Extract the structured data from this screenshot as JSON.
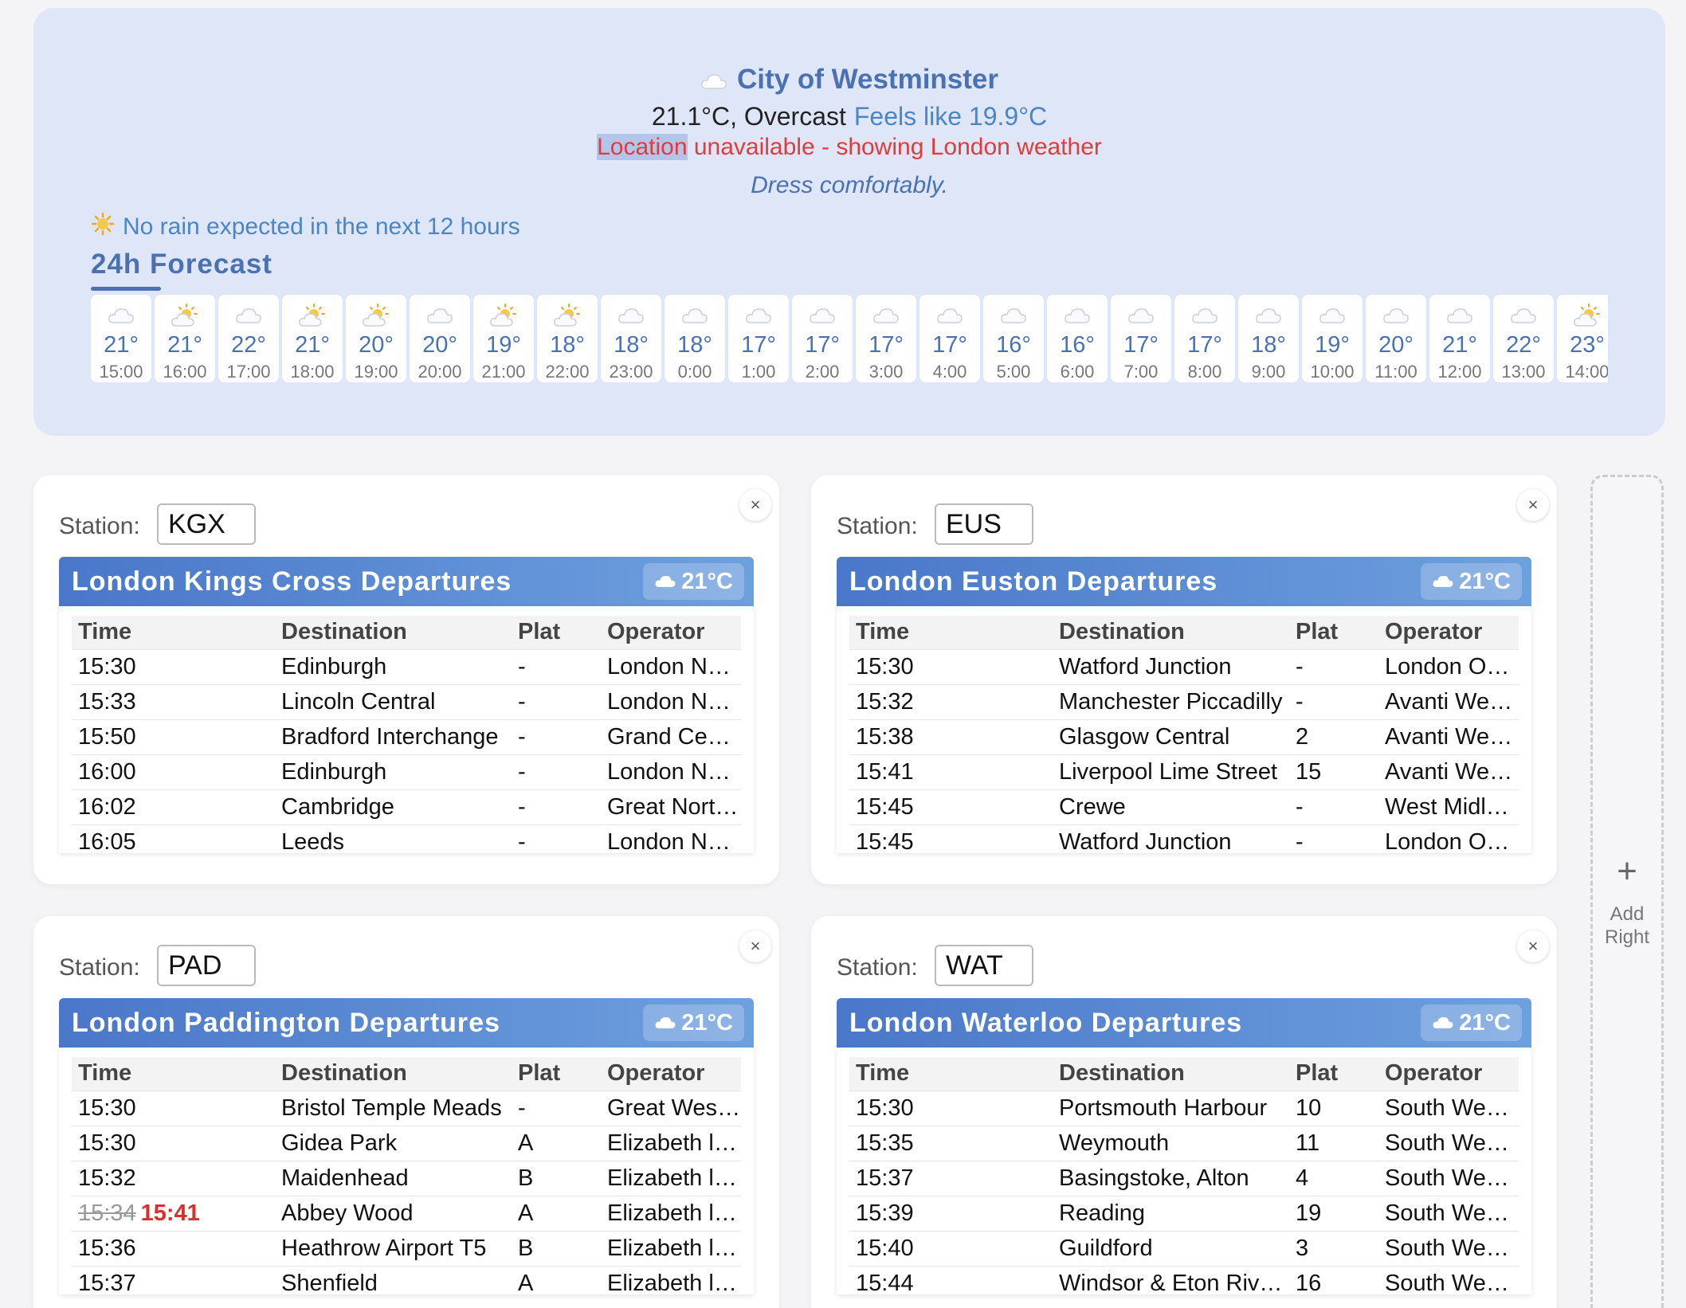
{
  "weather": {
    "city": "City of Westminster",
    "temp_line": "21.1°C, Overcast",
    "feels_like": "Feels like 19.9°C",
    "location_word": "Location",
    "location_rest": " unavailable - showing London weather",
    "advice": "Dress comfortably.",
    "rain_note": "No rain expected in the next 12 hours",
    "forecast_title": "24h Forecast",
    "forecast": [
      {
        "temp": "21°",
        "time": "15:00",
        "icon": "cloud-icon"
      },
      {
        "temp": "21°",
        "time": "16:00",
        "icon": "sun-cloud-icon"
      },
      {
        "temp": "22°",
        "time": "17:00",
        "icon": "cloud-icon"
      },
      {
        "temp": "21°",
        "time": "18:00",
        "icon": "sun-cloud-icon"
      },
      {
        "temp": "20°",
        "time": "19:00",
        "icon": "sun-cloud-icon"
      },
      {
        "temp": "20°",
        "time": "20:00",
        "icon": "cloud-icon"
      },
      {
        "temp": "19°",
        "time": "21:00",
        "icon": "sun-cloud-icon"
      },
      {
        "temp": "18°",
        "time": "22:00",
        "icon": "sun-cloud-icon"
      },
      {
        "temp": "18°",
        "time": "23:00",
        "icon": "cloud-icon"
      },
      {
        "temp": "18°",
        "time": "0:00",
        "icon": "cloud-icon"
      },
      {
        "temp": "17°",
        "time": "1:00",
        "icon": "cloud-icon"
      },
      {
        "temp": "17°",
        "time": "2:00",
        "icon": "cloud-icon"
      },
      {
        "temp": "17°",
        "time": "3:00",
        "icon": "cloud-icon"
      },
      {
        "temp": "17°",
        "time": "4:00",
        "icon": "cloud-icon"
      },
      {
        "temp": "16°",
        "time": "5:00",
        "icon": "cloud-icon"
      },
      {
        "temp": "16°",
        "time": "6:00",
        "icon": "cloud-icon"
      },
      {
        "temp": "17°",
        "time": "7:00",
        "icon": "cloud-icon"
      },
      {
        "temp": "17°",
        "time": "8:00",
        "icon": "cloud-icon"
      },
      {
        "temp": "18°",
        "time": "9:00",
        "icon": "cloud-icon"
      },
      {
        "temp": "19°",
        "time": "10:00",
        "icon": "cloud-icon"
      },
      {
        "temp": "20°",
        "time": "11:00",
        "icon": "cloud-icon"
      },
      {
        "temp": "21°",
        "time": "12:00",
        "icon": "cloud-icon"
      },
      {
        "temp": "22°",
        "time": "13:00",
        "icon": "cloud-icon"
      },
      {
        "temp": "23°",
        "time": "14:00",
        "icon": "sun-cloud-icon"
      }
    ]
  },
  "stations": [
    {
      "label": "Station:",
      "code": "KGX",
      "title": "London Kings Cross Departures",
      "temp": "21°C",
      "close": "×",
      "headers": [
        "Time",
        "Destination",
        "Plat",
        "Operator"
      ],
      "rows": [
        {
          "time": "15:30",
          "dest": "Edinburgh",
          "plat": "-",
          "op": "London North Eastern Railway"
        },
        {
          "time": "15:33",
          "dest": "Lincoln Central",
          "plat": "-",
          "op": "London North Eastern Railway"
        },
        {
          "time": "15:50",
          "dest": "Bradford Interchange",
          "plat": "-",
          "op": "Grand Central"
        },
        {
          "time": "16:00",
          "dest": "Edinburgh",
          "plat": "-",
          "op": "London North Eastern Railway"
        },
        {
          "time": "16:02",
          "dest": "Cambridge",
          "plat": "-",
          "op": "Great Northern"
        },
        {
          "time": "16:05",
          "dest": "Leeds",
          "plat": "-",
          "op": "London North Eastern Railway"
        }
      ]
    },
    {
      "label": "Station:",
      "code": "EUS",
      "title": "London Euston Departures",
      "temp": "21°C",
      "close": "×",
      "headers": [
        "Time",
        "Destination",
        "Plat",
        "Operator"
      ],
      "rows": [
        {
          "time": "15:30",
          "dest": "Watford Junction",
          "plat": "-",
          "op": "London Overground"
        },
        {
          "time": "15:32",
          "dest": "Manchester Piccadilly",
          "plat": "-",
          "op": "Avanti West Coast"
        },
        {
          "time": "15:38",
          "dest": "Glasgow Central",
          "plat": "2",
          "op": "Avanti West Coast"
        },
        {
          "time": "15:41",
          "dest": "Liverpool Lime Street",
          "plat": "15",
          "op": "Avanti West Coast"
        },
        {
          "time": "15:45",
          "dest": "Crewe",
          "plat": "-",
          "op": "West Midlands Trains"
        },
        {
          "time": "15:45",
          "dest": "Watford Junction",
          "plat": "-",
          "op": "London Overground"
        }
      ]
    },
    {
      "label": "Station:",
      "code": "PAD",
      "title": "London Paddington Departures",
      "temp": "21°C",
      "close": "×",
      "headers": [
        "Time",
        "Destination",
        "Plat",
        "Operator"
      ],
      "rows": [
        {
          "time": "15:30",
          "dest": "Bristol Temple Meads",
          "plat": "-",
          "op": "Great Western Railway"
        },
        {
          "time": "15:30",
          "dest": "Gidea Park",
          "plat": "A",
          "op": "Elizabeth line"
        },
        {
          "time": "15:32",
          "dest": "Maidenhead",
          "plat": "B",
          "op": "Elizabeth line"
        },
        {
          "time": "15:34",
          "delayed": "15:41",
          "dest": "Abbey Wood",
          "plat": "A",
          "op": "Elizabeth line"
        },
        {
          "time": "15:36",
          "dest": "Heathrow Airport T5",
          "plat": "B",
          "op": "Elizabeth line"
        },
        {
          "time": "15:37",
          "dest": "Shenfield",
          "plat": "A",
          "op": "Elizabeth line"
        }
      ]
    },
    {
      "label": "Station:",
      "code": "WAT",
      "title": "London Waterloo Departures",
      "temp": "21°C",
      "close": "×",
      "headers": [
        "Time",
        "Destination",
        "Plat",
        "Operator"
      ],
      "rows": [
        {
          "time": "15:30",
          "dest": "Portsmouth Harbour",
          "plat": "10",
          "op": "South Western Railway"
        },
        {
          "time": "15:35",
          "dest": "Weymouth",
          "plat": "11",
          "op": "South Western Railway"
        },
        {
          "time": "15:37",
          "dest": "Basingstoke, Alton",
          "plat": "4",
          "op": "South Western Railway"
        },
        {
          "time": "15:39",
          "dest": "Reading",
          "plat": "19",
          "op": "South Western Railway"
        },
        {
          "time": "15:40",
          "dest": "Guildford",
          "plat": "3",
          "op": "South Western Railway"
        },
        {
          "time": "15:44",
          "dest": "Windsor & Eton Riverside",
          "plat": "16",
          "op": "South Western Railway"
        }
      ]
    }
  ],
  "add_right": {
    "plus": "+",
    "label_1": "Add",
    "label_2": "Right"
  },
  "colors": {
    "accent": "#4a72b3",
    "alert": "#e23b3b",
    "panel": "#dfe6f8",
    "delay": "#d9302c"
  }
}
